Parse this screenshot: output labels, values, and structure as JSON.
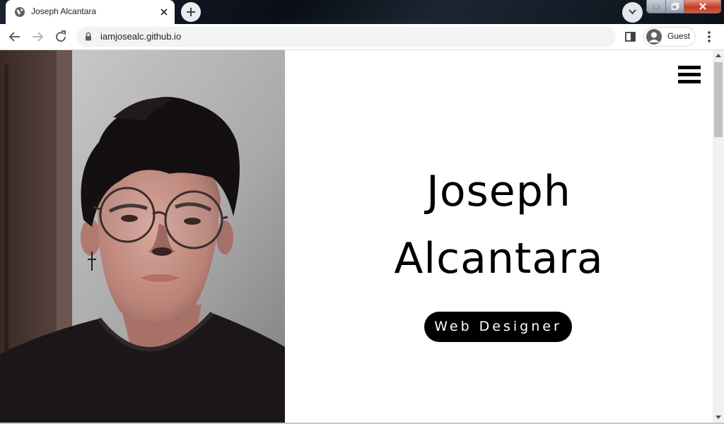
{
  "browser": {
    "tab": {
      "title": "Joseph Alcantara",
      "favicon": "globe-icon",
      "close_icon": "close-icon"
    },
    "new_tab_icon": "plus-icon",
    "tab_search_icon": "chevron-down-icon",
    "window_controls": [
      "minimize-icon",
      "restore-icon",
      "close-icon"
    ],
    "toolbar": {
      "back_icon": "arrow-left-icon",
      "forward_icon": "arrow-right-icon",
      "reload_icon": "reload-icon",
      "url": "iamjosealc.github.io",
      "lock_icon": "lock-icon",
      "side_panel_icon": "side-panel-icon",
      "profile_label": "Guest",
      "menu_icon": "kebab-menu-icon"
    }
  },
  "page": {
    "menu_icon": "hamburger-icon",
    "name_line1": "Joseph",
    "name_line2": "Alcantara",
    "role": "Web Designer",
    "accent": "#000000",
    "background": "#ffffff"
  }
}
